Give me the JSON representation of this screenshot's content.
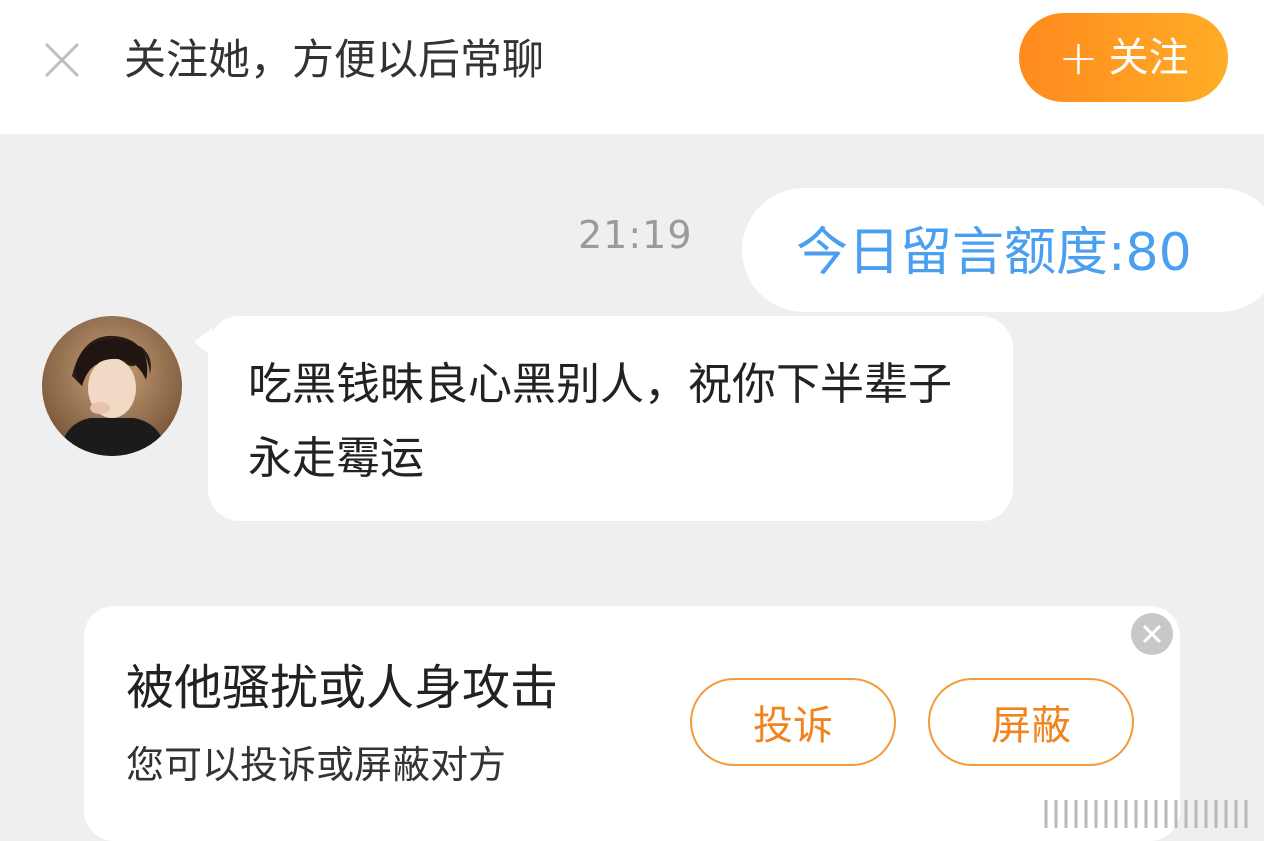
{
  "header": {
    "title": "关注她，方便以后常聊",
    "follow_label": "关注",
    "follow_plus": "+",
    "close_icon": "close-icon"
  },
  "chat": {
    "timestamp": "21:19",
    "outgoing_message": "今日留言额度:80",
    "incoming_message": "吃黑钱昧良心黑别人，祝你下半辈子永走霉运"
  },
  "report_card": {
    "title": "被他骚扰或人身攻击",
    "subtitle": "您可以投诉或屏蔽对方",
    "complain_label": "投诉",
    "block_label": "屏蔽"
  },
  "colors": {
    "accent_orange": "#ff9a22",
    "link_blue": "#4b9ff0",
    "background": "#efefef"
  }
}
